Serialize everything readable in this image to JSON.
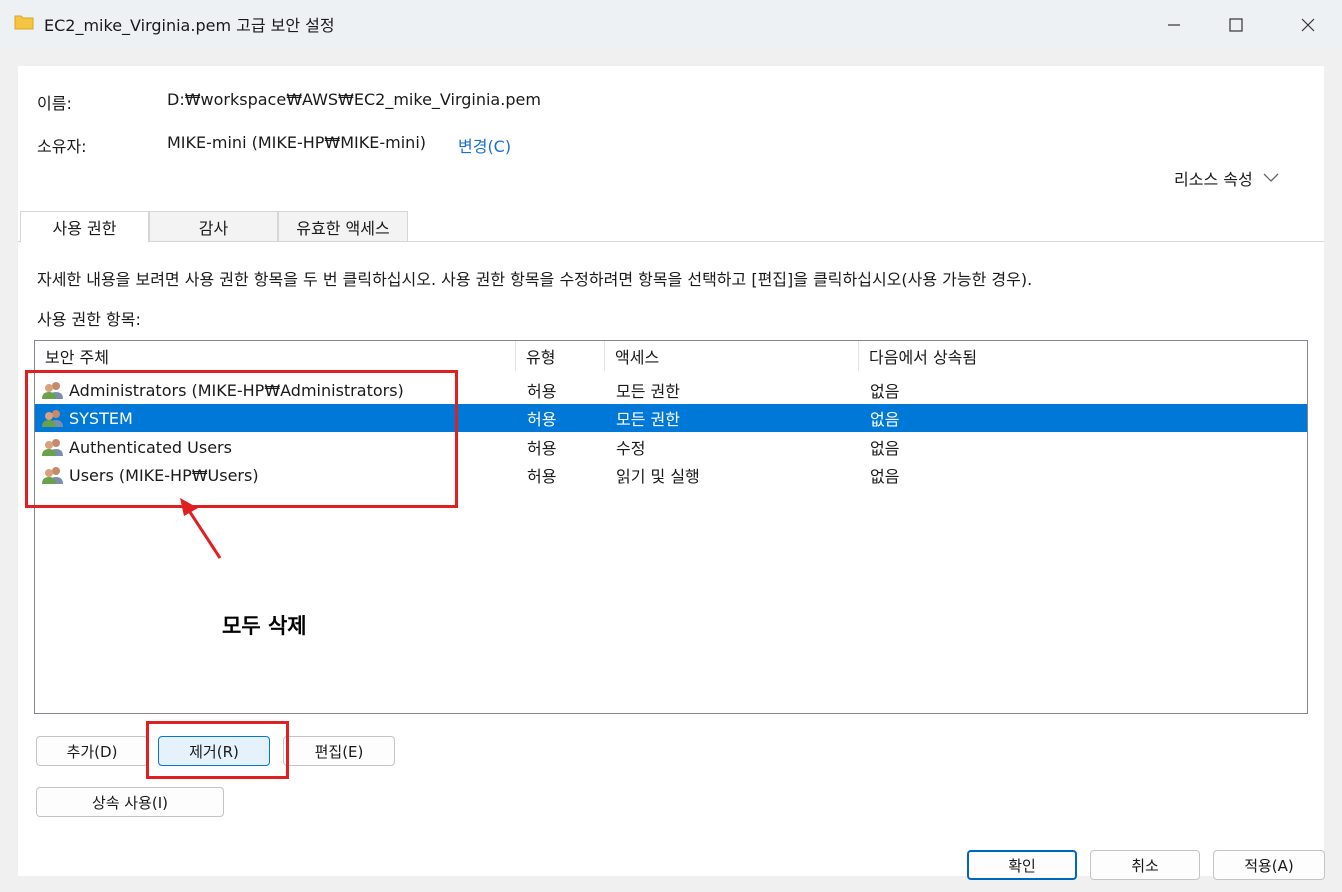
{
  "window": {
    "title": "EC2_mike_Virginia.pem 고급 보안 설정",
    "minimize_label": "—",
    "maximize_label": "☐",
    "close_label": "✕"
  },
  "info": {
    "name_label": "이름:",
    "name_value": "D:₩workspace₩AWS₩EC2_mike_Virginia.pem",
    "owner_label": "소유자:",
    "owner_value": "MIKE-mini (MIKE-HP₩MIKE-mini)",
    "change_link": "변경(C)",
    "resource_properties": "리소스 속성"
  },
  "tabs": [
    {
      "label": "사용 권한",
      "active": true
    },
    {
      "label": "감사",
      "active": false
    },
    {
      "label": "유효한 액세스",
      "active": false
    }
  ],
  "description": "자세한 내용을 보려면 사용 권한 항목을 두 번 클릭하십시오. 사용 권한 항목을 수정하려면 항목을 선택하고 [편집]을 클릭하십시오(사용 가능한 경우).",
  "list_label": "사용 권한 항목:",
  "columns": [
    "보안 주체",
    "유형",
    "액세스",
    "다음에서 상속됨"
  ],
  "entries": [
    {
      "principal": "Administrators (MIKE-HP₩Administrators)",
      "type": "허용",
      "access": "모든 권한",
      "inherited_from": "없음",
      "selected": false
    },
    {
      "principal": "SYSTEM",
      "type": "허용",
      "access": "모든 권한",
      "inherited_from": "없음",
      "selected": true
    },
    {
      "principal": "Authenticated Users",
      "type": "허용",
      "access": "수정",
      "inherited_from": "없음",
      "selected": false
    },
    {
      "principal": "Users (MIKE-HP₩Users)",
      "type": "허용",
      "access": "읽기 및 실행",
      "inherited_from": "없음",
      "selected": false
    }
  ],
  "annotation": "모두 삭제",
  "buttons": {
    "add": "추가(D)",
    "remove": "제거(R)",
    "edit": "편집(E)",
    "inheritance": "상속 사용(I)",
    "ok": "확인",
    "cancel": "취소",
    "apply": "적용(A)"
  },
  "colors": {
    "selection": "#0078d7",
    "link": "#1a6fd1",
    "annotation_box": "#e02020"
  }
}
